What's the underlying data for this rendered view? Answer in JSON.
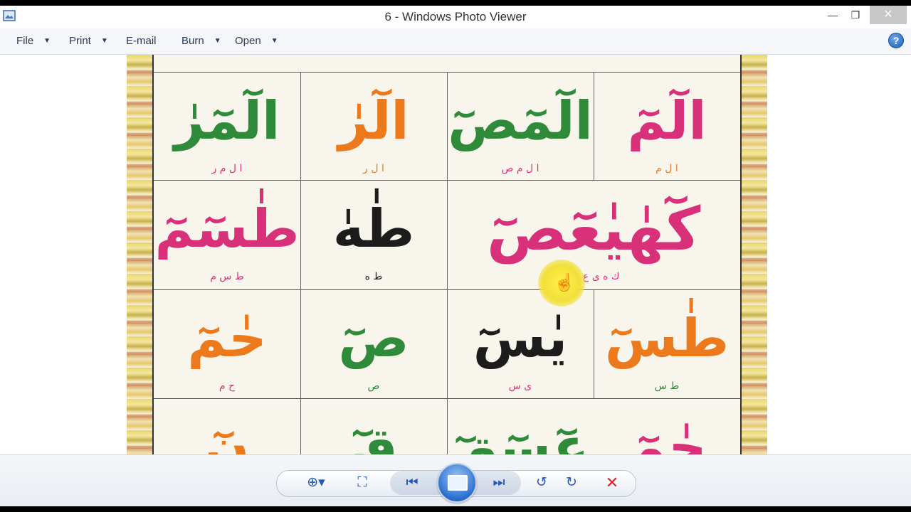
{
  "window": {
    "title": "6 - Windows Photo Viewer",
    "controls": {
      "minimize": "—",
      "restore": "❐",
      "close": "✕"
    }
  },
  "menu": {
    "items": [
      {
        "label": "File",
        "has_dropdown": true
      },
      {
        "label": "Print",
        "has_dropdown": true
      },
      {
        "label": "E-mail",
        "has_dropdown": false
      },
      {
        "label": "Burn",
        "has_dropdown": true
      },
      {
        "label": "Open",
        "has_dropdown": true
      }
    ],
    "help": "?"
  },
  "photo": {
    "cells": [
      {
        "text": "الٓمٓ",
        "letters": "ا ل م",
        "color": "#d8317a"
      },
      {
        "text": "الٓمٓصٓ",
        "letters": "ا ل م ص",
        "color": "#2f8a3a"
      },
      {
        "text": "الٓرٰ",
        "letters": "ا ل ر",
        "color": "#2f8a3a"
      },
      {
        "text": "الٓمٓرٰ",
        "letters": "ا ل م ر",
        "color": "#2f8a3a"
      },
      {
        "text": "كٓهٰيٰعٓصٓ",
        "letters": "ك ه ى ع ص",
        "color": "#d8317a"
      },
      {
        "text": "طٰهٰ",
        "letters": "ط ه",
        "color": "#1c1c1c"
      },
      {
        "text": "طٰسٓمٓ",
        "letters": "ط س م",
        "color": "#d8317a"
      },
      {
        "text": "طٰسٓ",
        "letters": "ط س",
        "color": "#ec7a1c"
      },
      {
        "text": "يٰسٓ",
        "letters": "ى س",
        "color": "#1c1c1c"
      },
      {
        "text": "صٓ",
        "letters": "ص",
        "color": "#2f8a3a"
      },
      {
        "text": "حٰمٓ",
        "letters": "ح م",
        "color": "#ec7a1c"
      },
      {
        "text": "حٰمٓ",
        "letters": "",
        "color": "#d8317a"
      },
      {
        "text": "عٓسٓقٓ",
        "letters": "",
        "color": "#2f8a3a"
      },
      {
        "text": "قٓ",
        "letters": "",
        "color": "#2f8a3a"
      },
      {
        "text": "نٓ",
        "letters": "",
        "color": "#ec7a1c"
      }
    ]
  },
  "toolbar": {
    "zoom": "⊕▾",
    "fit": "⛶",
    "previous": "⏮",
    "next": "⏭",
    "rotate_ccw": "↺",
    "rotate_cw": "↻",
    "delete": "✕"
  },
  "colors": {
    "accent": "#2258b8",
    "close_button": "#c7c7c7",
    "delete": "#dd2222"
  }
}
